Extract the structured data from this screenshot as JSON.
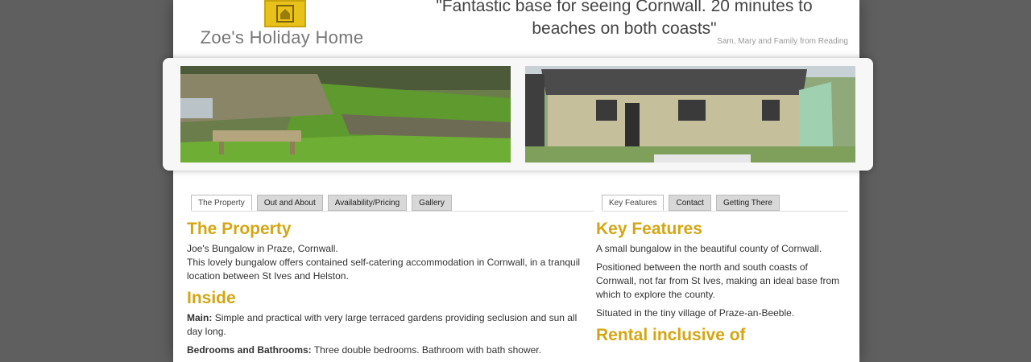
{
  "header": {
    "site_name": "Zoe's Holiday Home",
    "quote": "\"Fantastic base for seeing Cornwall. 20 minutes to beaches on both coasts\"",
    "quote_source": "Sam, Mary and Family from Reading"
  },
  "colors": {
    "page_bg": "#5f5f5f",
    "heading": "#d4a614",
    "logo": "#e8c21a"
  },
  "photos": [
    {
      "icon": "garden-photo"
    },
    {
      "icon": "bungalow-photo"
    }
  ],
  "tabs_left": [
    {
      "label": "The Property",
      "active": true
    },
    {
      "label": "Out and About",
      "active": false
    },
    {
      "label": "Availability/Pricing",
      "active": false
    },
    {
      "label": "Gallery",
      "active": false
    }
  ],
  "tabs_right": [
    {
      "label": "Key Features",
      "active": true
    },
    {
      "label": "Contact",
      "active": false
    },
    {
      "label": "Getting There",
      "active": false
    }
  ],
  "left": {
    "heading1": "The Property",
    "line1": "Joe's Bungalow in Praze, Cornwall.",
    "line2": "This lovely bungalow offers contained self-catering accommodation in Cornwall, in a tranquil location between St Ives and Helston.",
    "heading2": "Inside",
    "main_label": "Main:",
    "main_text": "Simple and practical with very large terraced gardens providing seclusion and sun all day long.",
    "bed_label": "Bedrooms and Bathrooms:",
    "bed_text": "Three double bedrooms. Bathroom with bath shower."
  },
  "right": {
    "heading1": "Key Features",
    "p1": "A small bungalow in the beautiful county of Cornwall.",
    "p2": "Positioned between the north and south coasts of Cornwall, not far from St Ives, making an ideal base from which to explore the county.",
    "p3": "Situated in the tiny village of Praze-an-Beeble.",
    "heading2": "Rental inclusive of"
  }
}
